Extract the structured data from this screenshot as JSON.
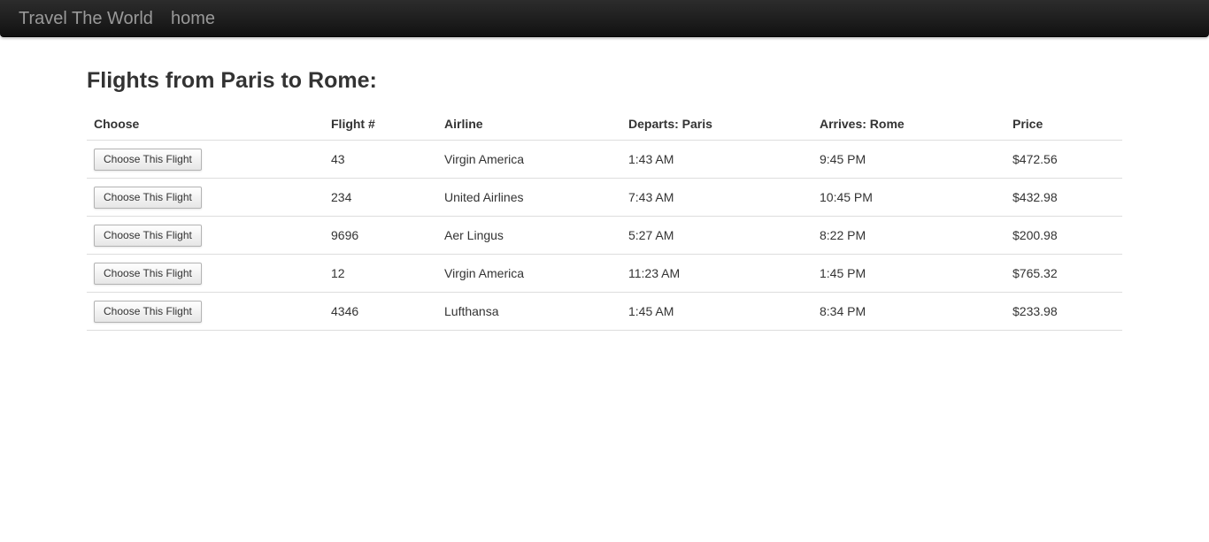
{
  "navbar": {
    "brand": "Travel The World",
    "home": "home"
  },
  "page": {
    "title": "Flights from Paris to Rome:"
  },
  "table": {
    "headers": {
      "choose": "Choose",
      "flight": "Flight #",
      "airline": "Airline",
      "departs": "Departs: Paris",
      "arrives": "Arrives: Rome",
      "price": "Price"
    },
    "rows": [
      {
        "button": "Choose This Flight",
        "flight": "43",
        "airline": "Virgin America",
        "departs": "1:43 AM",
        "arrives": "9:45 PM",
        "price": "$472.56"
      },
      {
        "button": "Choose This Flight",
        "flight": "234",
        "airline": "United Airlines",
        "departs": "7:43 AM",
        "arrives": "10:45 PM",
        "price": "$432.98"
      },
      {
        "button": "Choose This Flight",
        "flight": "9696",
        "airline": "Aer Lingus",
        "departs": "5:27 AM",
        "arrives": "8:22 PM",
        "price": "$200.98"
      },
      {
        "button": "Choose This Flight",
        "flight": "12",
        "airline": "Virgin America",
        "departs": "11:23 AM",
        "arrives": "1:45 PM",
        "price": "$765.32"
      },
      {
        "button": "Choose This Flight",
        "flight": "4346",
        "airline": "Lufthansa",
        "departs": "1:45 AM",
        "arrives": "8:34 PM",
        "price": "$233.98"
      }
    ]
  },
  "colors": {
    "navbar_bg": "#1b1b1b",
    "navbar_text": "#999999",
    "text": "#333333",
    "row_border": "#dddddd"
  }
}
